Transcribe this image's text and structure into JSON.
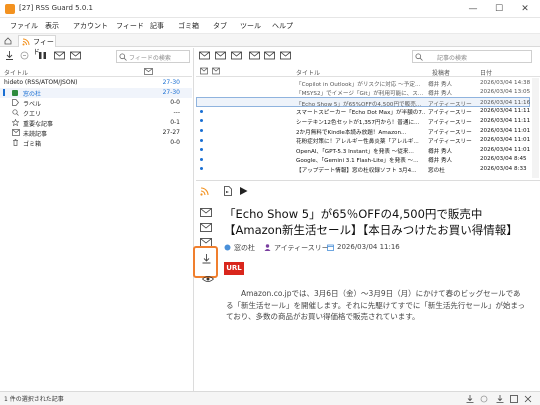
{
  "window": {
    "title": "[27] RSS Guard 5.0.1",
    "controls": [
      "—",
      "☐",
      "✕"
    ]
  },
  "menu": [
    "ファイル",
    "表示",
    "アカウント",
    "フィード",
    "記事",
    "ゴミ箱",
    "タブ",
    "ツール",
    "ヘルプ"
  ],
  "tab": {
    "label": "フィード"
  },
  "feeds": {
    "search_placeholder": "フィードの検索",
    "col_title": "タイトル",
    "items": [
      {
        "label": "hideto (RSS/ATOM/JSON)",
        "count": "27-30"
      },
      {
        "label": "窓の杜",
        "count": "27-30"
      },
      {
        "label": "ラベル",
        "count": "0-0"
      },
      {
        "label": "クエリ",
        "count": "---"
      },
      {
        "label": "重要な記事",
        "count": "0-1"
      },
      {
        "label": "未読記事",
        "count": "27-27"
      },
      {
        "label": "ゴミ箱",
        "count": "0-0"
      }
    ]
  },
  "articles": {
    "search_placeholder": "記事の検索",
    "col_title": "タイトル",
    "col_author": "投稿者",
    "col_date": "日付",
    "items": [
      {
        "title": "「Copilot in Outlook」がリスクに対応 〜予定...",
        "author": "樽井 秀人",
        "date": "2026/03/04 14:38",
        "unread": false
      },
      {
        "title": "「MSYS2」でイメージ「Git」が利用可能に、ス...",
        "author": "樽井 秀人",
        "date": "2026/03/04 13:05",
        "unread": false
      },
      {
        "title": "「Echo Show 5」が65%OFFの4,500円で販売...",
        "author": "アイティースリー",
        "date": "2026/03/04 11:16",
        "unread": false
      },
      {
        "title": "スマートスピーカー「Echo Dot Max」が半額の7...",
        "author": "アイティースリー",
        "date": "2026/03/04 11:11",
        "unread": true
      },
      {
        "title": "シーテキン12色セットが1,357円から！普通に...",
        "author": "アイティースリー",
        "date": "2026/03/04 11:11",
        "unread": true
      },
      {
        "title": "2か月無料でKindle本読み放題！Amazon...",
        "author": "アイティースリー",
        "date": "2026/03/04 11:01",
        "unread": true
      },
      {
        "title": "花粉症対策に！アレルギー性鼻炎薬「アレルギ...",
        "author": "アイティースリー",
        "date": "2026/03/04 11:01",
        "unread": true
      },
      {
        "title": "OpenAI、「GPT-5.3 Instant」を発表 〜従来...",
        "author": "樽井 秀人",
        "date": "2026/03/04 11:01",
        "unread": true
      },
      {
        "title": "Google、「Gemini 3.1 Flash-Lite」を発表 〜...",
        "author": "樽井 秀人",
        "date": "2026/03/04 8:45",
        "unread": true
      },
      {
        "title": "【アップデート情報】窓の杜収録ソフト 3月4...",
        "author": "窓の杜",
        "date": "2026/03/04 8:33",
        "unread": true
      }
    ]
  },
  "preview": {
    "title": "「Echo Show 5」が65％OFFの4,500円で販売中【Amazon新生活セール】【本日みつけたお買い得情報】",
    "feed": "窓の杜",
    "author": "アイティースリー",
    "date": "2026/03/04 11:16",
    "url_badge": "URL",
    "body": "Amazon.co.jpでは、3月6日（金）〜3月9日（月）にかけて春のビッグセールである「新生活セール」を開催します。それに先駆けてすでに「新生活先行セール」が始まっており、多数の商品がお買い得価格で販売されています。"
  },
  "status": {
    "text": "1 件の選択された記事"
  },
  "colors": {
    "accent": "#1a6fd3",
    "highlight": "#f07f2e",
    "rss": "#f39220",
    "url_red": "#d9261c",
    "selected_row": "#dde9f7"
  }
}
